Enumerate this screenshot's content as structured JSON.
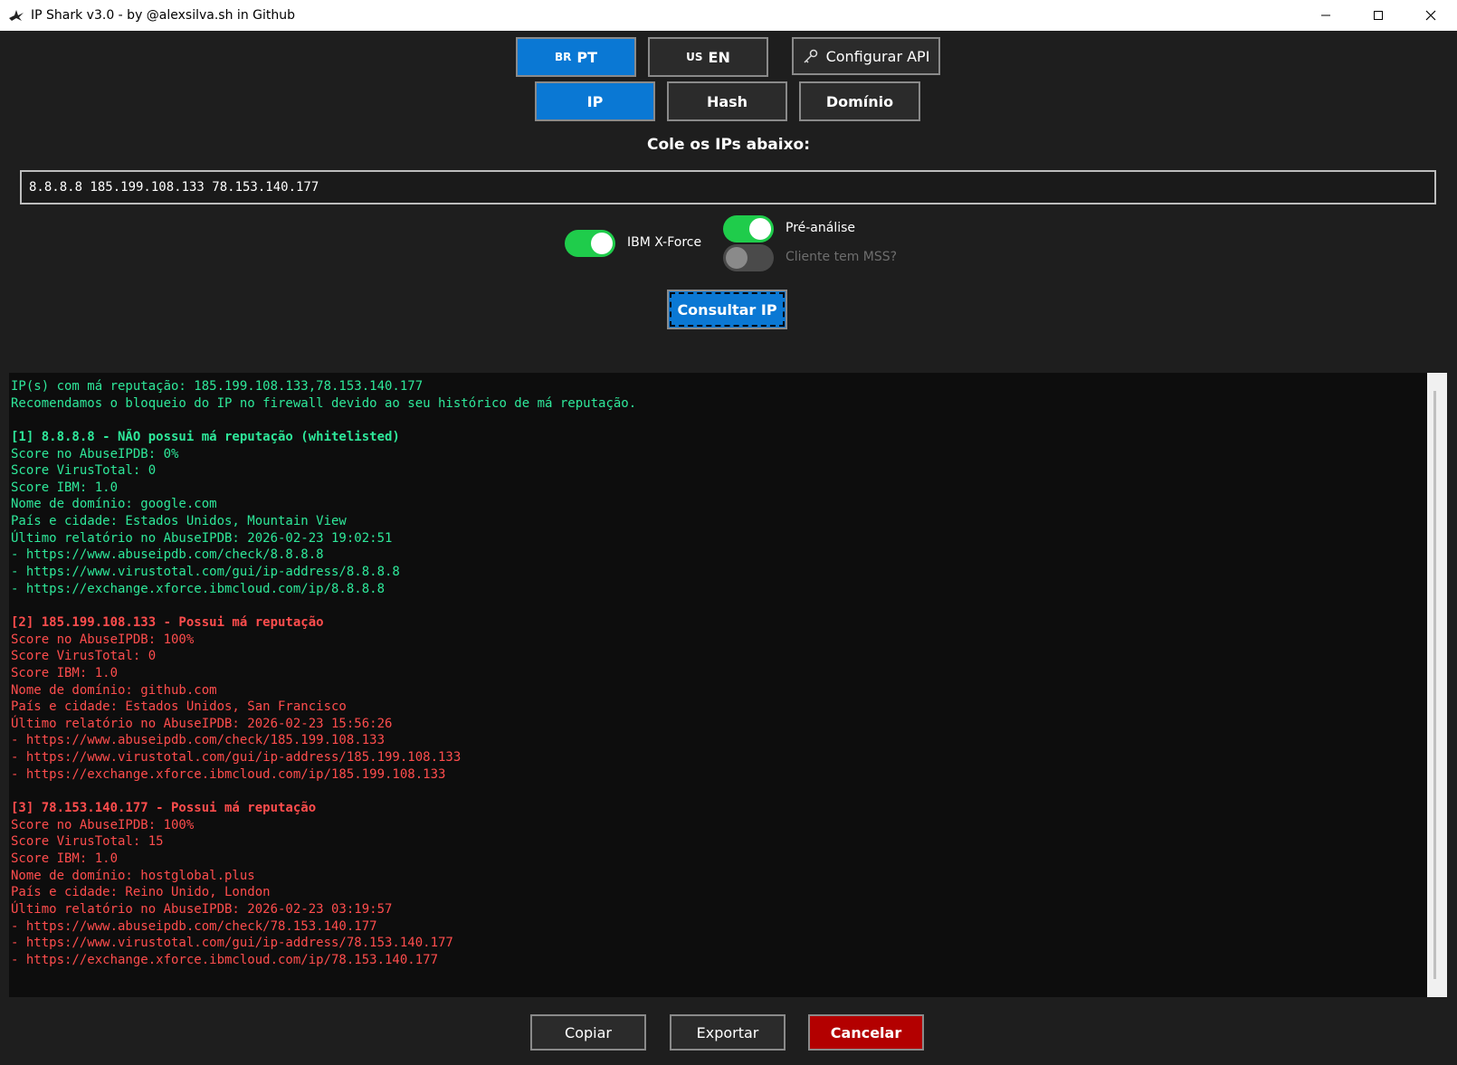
{
  "window": {
    "title": "IP Shark v3.0 - by @alexsilva.sh in Github",
    "app_icon": "shark-icon"
  },
  "toolbar": {
    "lang_pt_flag": "BR",
    "lang_pt_label": "PT",
    "lang_en_flag": "US",
    "lang_en_label": "EN",
    "config_api_label": "Configurar API",
    "config_api_icon": "key-icon"
  },
  "modes": {
    "ip_label": "IP",
    "hash_label": "Hash",
    "domain_label": "Domínio",
    "active": "IP"
  },
  "input": {
    "prompt": "Cole os IPs abaixo:",
    "value": "8.8.8.8 185.199.108.133 78.153.140.177"
  },
  "options": {
    "xforce_label": "IBM X-Force",
    "xforce_on": true,
    "pre_analysis_label": "Pré-análise",
    "pre_analysis_on": true,
    "mss_label": "Cliente tem MSS?",
    "mss_on": false
  },
  "actions": {
    "query_label": "Consultar IP",
    "copy_label": "Copiar",
    "export_label": "Exportar",
    "cancel_label": "Cancelar"
  },
  "colors": {
    "accent": "#0a78d4",
    "good": "#2ee89a",
    "bad": "#ff4d4d",
    "toggle_on": "#1fcc4b",
    "cancel": "#b30000"
  },
  "output": {
    "lines": [
      {
        "text": "IP(s) com má reputação: 185.199.108.133,78.153.140.177",
        "color": "green",
        "bold": false
      },
      {
        "text": "Recomendamos o bloqueio do IP no firewall devido ao seu histórico de má reputação.",
        "color": "green",
        "bold": false
      },
      {
        "text": "",
        "color": "green",
        "bold": false
      },
      {
        "text": "[1] 8.8.8.8 - NÃO possui má reputação (whitelisted)",
        "color": "green",
        "bold": true
      },
      {
        "text": "Score no AbuseIPDB: 0%",
        "color": "green",
        "bold": false
      },
      {
        "text": "Score VirusTotal: 0",
        "color": "green",
        "bold": false
      },
      {
        "text": "Score IBM: 1.0",
        "color": "green",
        "bold": false
      },
      {
        "text": "Nome de domínio: google.com",
        "color": "green",
        "bold": false
      },
      {
        "text": "País e cidade: Estados Unidos, Mountain View",
        "color": "green",
        "bold": false
      },
      {
        "text": "Último relatório no AbuseIPDB: 2026-02-23 19:02:51",
        "color": "green",
        "bold": false
      },
      {
        "text": "- https://www.abuseipdb.com/check/8.8.8.8",
        "color": "green",
        "bold": false
      },
      {
        "text": "- https://www.virustotal.com/gui/ip-address/8.8.8.8",
        "color": "green",
        "bold": false
      },
      {
        "text": "- https://exchange.xforce.ibmcloud.com/ip/8.8.8.8",
        "color": "green",
        "bold": false
      },
      {
        "text": "",
        "color": "green",
        "bold": false
      },
      {
        "text": "[2] 185.199.108.133 - Possui má reputação",
        "color": "red",
        "bold": true
      },
      {
        "text": "Score no AbuseIPDB: 100%",
        "color": "red",
        "bold": false
      },
      {
        "text": "Score VirusTotal: 0",
        "color": "red",
        "bold": false
      },
      {
        "text": "Score IBM: 1.0",
        "color": "red",
        "bold": false
      },
      {
        "text": "Nome de domínio: github.com",
        "color": "red",
        "bold": false
      },
      {
        "text": "País e cidade: Estados Unidos, San Francisco",
        "color": "red",
        "bold": false
      },
      {
        "text": "Último relatório no AbuseIPDB: 2026-02-23 15:56:26",
        "color": "red",
        "bold": false
      },
      {
        "text": "- https://www.abuseipdb.com/check/185.199.108.133",
        "color": "red",
        "bold": false
      },
      {
        "text": "- https://www.virustotal.com/gui/ip-address/185.199.108.133",
        "color": "red",
        "bold": false
      },
      {
        "text": "- https://exchange.xforce.ibmcloud.com/ip/185.199.108.133",
        "color": "red",
        "bold": false
      },
      {
        "text": "",
        "color": "red",
        "bold": false
      },
      {
        "text": "[3] 78.153.140.177 - Possui má reputação",
        "color": "red",
        "bold": true
      },
      {
        "text": "Score no AbuseIPDB: 100%",
        "color": "red",
        "bold": false
      },
      {
        "text": "Score VirusTotal: 15",
        "color": "red",
        "bold": false
      },
      {
        "text": "Score IBM: 1.0",
        "color": "red",
        "bold": false
      },
      {
        "text": "Nome de domínio: hostglobal.plus",
        "color": "red",
        "bold": false
      },
      {
        "text": "País e cidade: Reino Unido, London",
        "color": "red",
        "bold": false
      },
      {
        "text": "Último relatório no AbuseIPDB: 2026-02-23 03:19:57",
        "color": "red",
        "bold": false
      },
      {
        "text": "- https://www.abuseipdb.com/check/78.153.140.177",
        "color": "red",
        "bold": false
      },
      {
        "text": "- https://www.virustotal.com/gui/ip-address/78.153.140.177",
        "color": "red",
        "bold": false
      },
      {
        "text": "- https://exchange.xforce.ibmcloud.com/ip/78.153.140.177",
        "color": "red",
        "bold": false
      }
    ]
  }
}
